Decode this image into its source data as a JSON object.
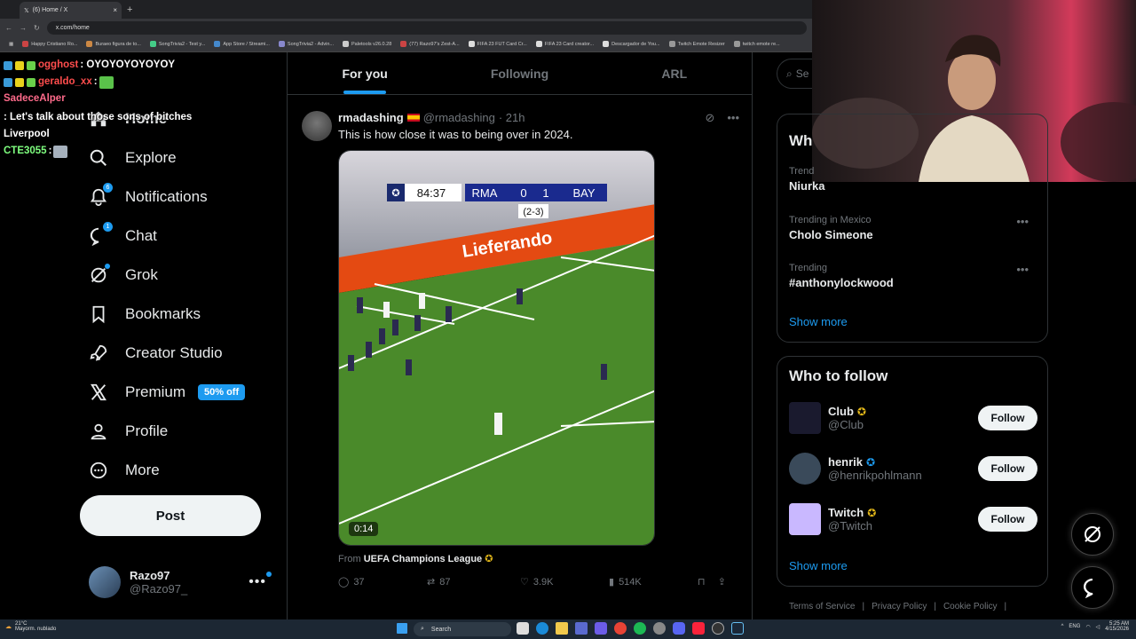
{
  "browser": {
    "tab_title": "(6) Home / X",
    "tab_close": "×",
    "new_tab": "+",
    "address": "x.com/home",
    "bookmarks": [
      "Happy Cristiano Ro...",
      "Buraeo figura de to...",
      "SongTrivia2 - Test y...",
      "App Store / Streami...",
      "SongTrivia2 - Advin...",
      "Paletools v26.0.28",
      "(77) Razo97's Zest-A...",
      "FIFA 23 FUT Card Cr...",
      "FIFA 23 Card creator...",
      "Descargador de You...",
      "Twitch Emote Resizer",
      "twitch emote re..."
    ]
  },
  "chat": [
    {
      "user": "ogghost",
      "user_color": "#ff4d4d",
      "message": ": OYOYOYOYOYOY"
    },
    {
      "user": "geraldo_xx",
      "user_color": "#ff4d4d",
      "message": ":"
    },
    {
      "user": "SadeceAlper",
      "user_color": "#ff6b8b",
      "message": ": Let's talk about those sons of bitches Liverpool"
    },
    {
      "user": "CTE3055",
      "user_color": "#7fff7f",
      "message": ":"
    }
  ],
  "nav": {
    "items": [
      {
        "label": "Home",
        "icon": "home-icon",
        "badge": ""
      },
      {
        "label": "Explore",
        "icon": "search-icon",
        "badge": ""
      },
      {
        "label": "Notifications",
        "icon": "bell-icon",
        "badge": "6"
      },
      {
        "label": "Chat",
        "icon": "chat-icon",
        "badge": "1"
      },
      {
        "label": "Grok",
        "icon": "grok-icon",
        "badge": ""
      },
      {
        "label": "Bookmarks",
        "icon": "bookmark-icon",
        "badge": ""
      },
      {
        "label": "Creator Studio",
        "icon": "rocket-icon",
        "badge": ""
      },
      {
        "label": "Premium",
        "icon": "x-logo-icon",
        "badge": ""
      },
      {
        "label": "Profile",
        "icon": "person-icon",
        "badge": ""
      },
      {
        "label": "More",
        "icon": "more-circle-icon",
        "badge": ""
      }
    ],
    "premium_offer": "50% off",
    "post_label": "Post"
  },
  "account": {
    "name": "Razo97",
    "handle": "@Razo97_",
    "more": "•••"
  },
  "feed": {
    "tabs": [
      "For you",
      "Following",
      "ARL"
    ],
    "active_tab": 0,
    "tweet": {
      "name": "rmadashing",
      "handle": "@rmadashing",
      "time": "· 21h",
      "text": "This is how close it was to being over in 2024.",
      "video": {
        "clock": "84:37",
        "home": "RMA",
        "home_score": "0",
        "away_score": "1",
        "away": "BAY",
        "aggregate": "(2-3)",
        "duration": "0:14",
        "board_text": "Lieferando"
      },
      "from_prefix": "From",
      "from_source": "UEFA Champions League",
      "replies": "37",
      "reposts": "87",
      "likes": "3.9K",
      "views": "514K"
    }
  },
  "right": {
    "search_placeholder": "Se",
    "trends_title": "Wh",
    "trends": [
      {
        "meta": "Trend",
        "name": "Niurka"
      },
      {
        "meta": "Trending in Mexico",
        "name": "Cholo Simeone"
      },
      {
        "meta": "Trending",
        "name": "#anthonylockwood"
      }
    ],
    "trends_more": "Show more",
    "wtf_title": "Who to follow",
    "people": [
      {
        "name": "Club",
        "handle": "@Club",
        "verified": "gold",
        "avatar_color": "#1a1a2e"
      },
      {
        "name": "henrik",
        "handle": "@henrikpohlmann",
        "verified": "blue",
        "avatar_color": "#3a4a5a"
      },
      {
        "name": "Twitch",
        "handle": "@Twitch",
        "verified": "gold",
        "avatar_color": "#c9b8ff"
      }
    ],
    "follow_label": "Follow",
    "wtf_more": "Show more",
    "footer": [
      "Terms of Service",
      "|",
      "Privacy Policy",
      "|",
      "Cookie Policy",
      "|"
    ]
  },
  "taskbar": {
    "weather_temp": "21°C",
    "weather_desc": "Mayorm. nublado",
    "search": "Search",
    "lang": "ENG",
    "time": "5:25 AM",
    "date": "4/15/2026"
  },
  "colors": {
    "accent": "#1d9bf0",
    "bg": "#000000",
    "border": "#2f3336",
    "muted": "#71767b"
  }
}
